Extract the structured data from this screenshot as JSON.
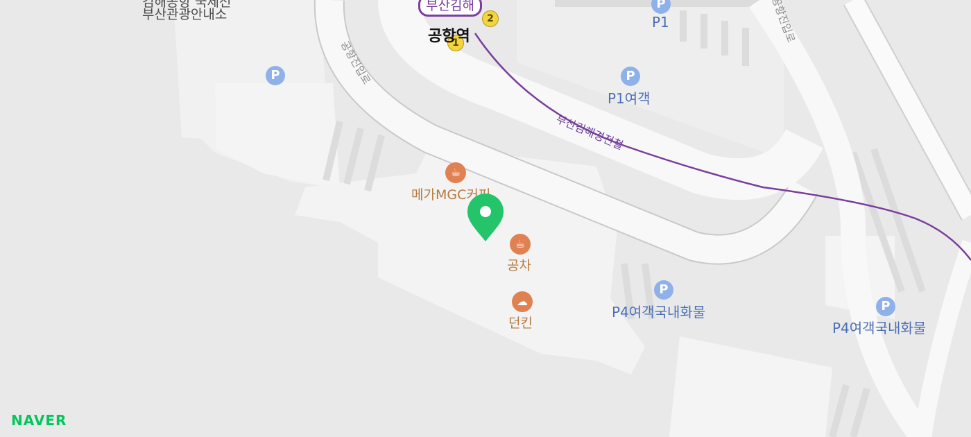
{
  "colors": {
    "background": "#e9e9ea",
    "road": "#f8f8f8",
    "road_edge": "#c9c9c9",
    "building": "#f1f1f1",
    "rail_line": "#7a3e9d",
    "parking_icon": "#8fb1ea",
    "parking_text": "#4a6fb5",
    "cafe_icon": "#e08152",
    "cafe_text": "#b67a3f",
    "marker": "#24c46a",
    "brand": "#03c75a"
  },
  "icons": {
    "parking": "P",
    "cafe": "cup-icon",
    "bakery": "cloud-icon",
    "marker": "location-pin-icon"
  },
  "labels": {
    "tourist_info_top": "김해공항 국제선",
    "tourist_info": "부산관광안내소",
    "station_line": "부산김해",
    "station_name": "공항역",
    "exit_1": "1",
    "exit_2": "2",
    "road_airport_entry_1": "공항진입로",
    "road_airport_entry_2": "공항진입로",
    "rail_name": "부산김해경전철",
    "parking_p1": "P1",
    "parking_p1_passenger": "P1여객",
    "parking_p4_a": "P4여객국내화물",
    "parking_p4_b": "P4여객국내화물",
    "cafe_mega": "메가MGC커피",
    "cafe_gongcha": "공차",
    "cafe_dunkin": "던킨",
    "parking_glyph": "P"
  },
  "brand": {
    "logo": "NAVER"
  }
}
